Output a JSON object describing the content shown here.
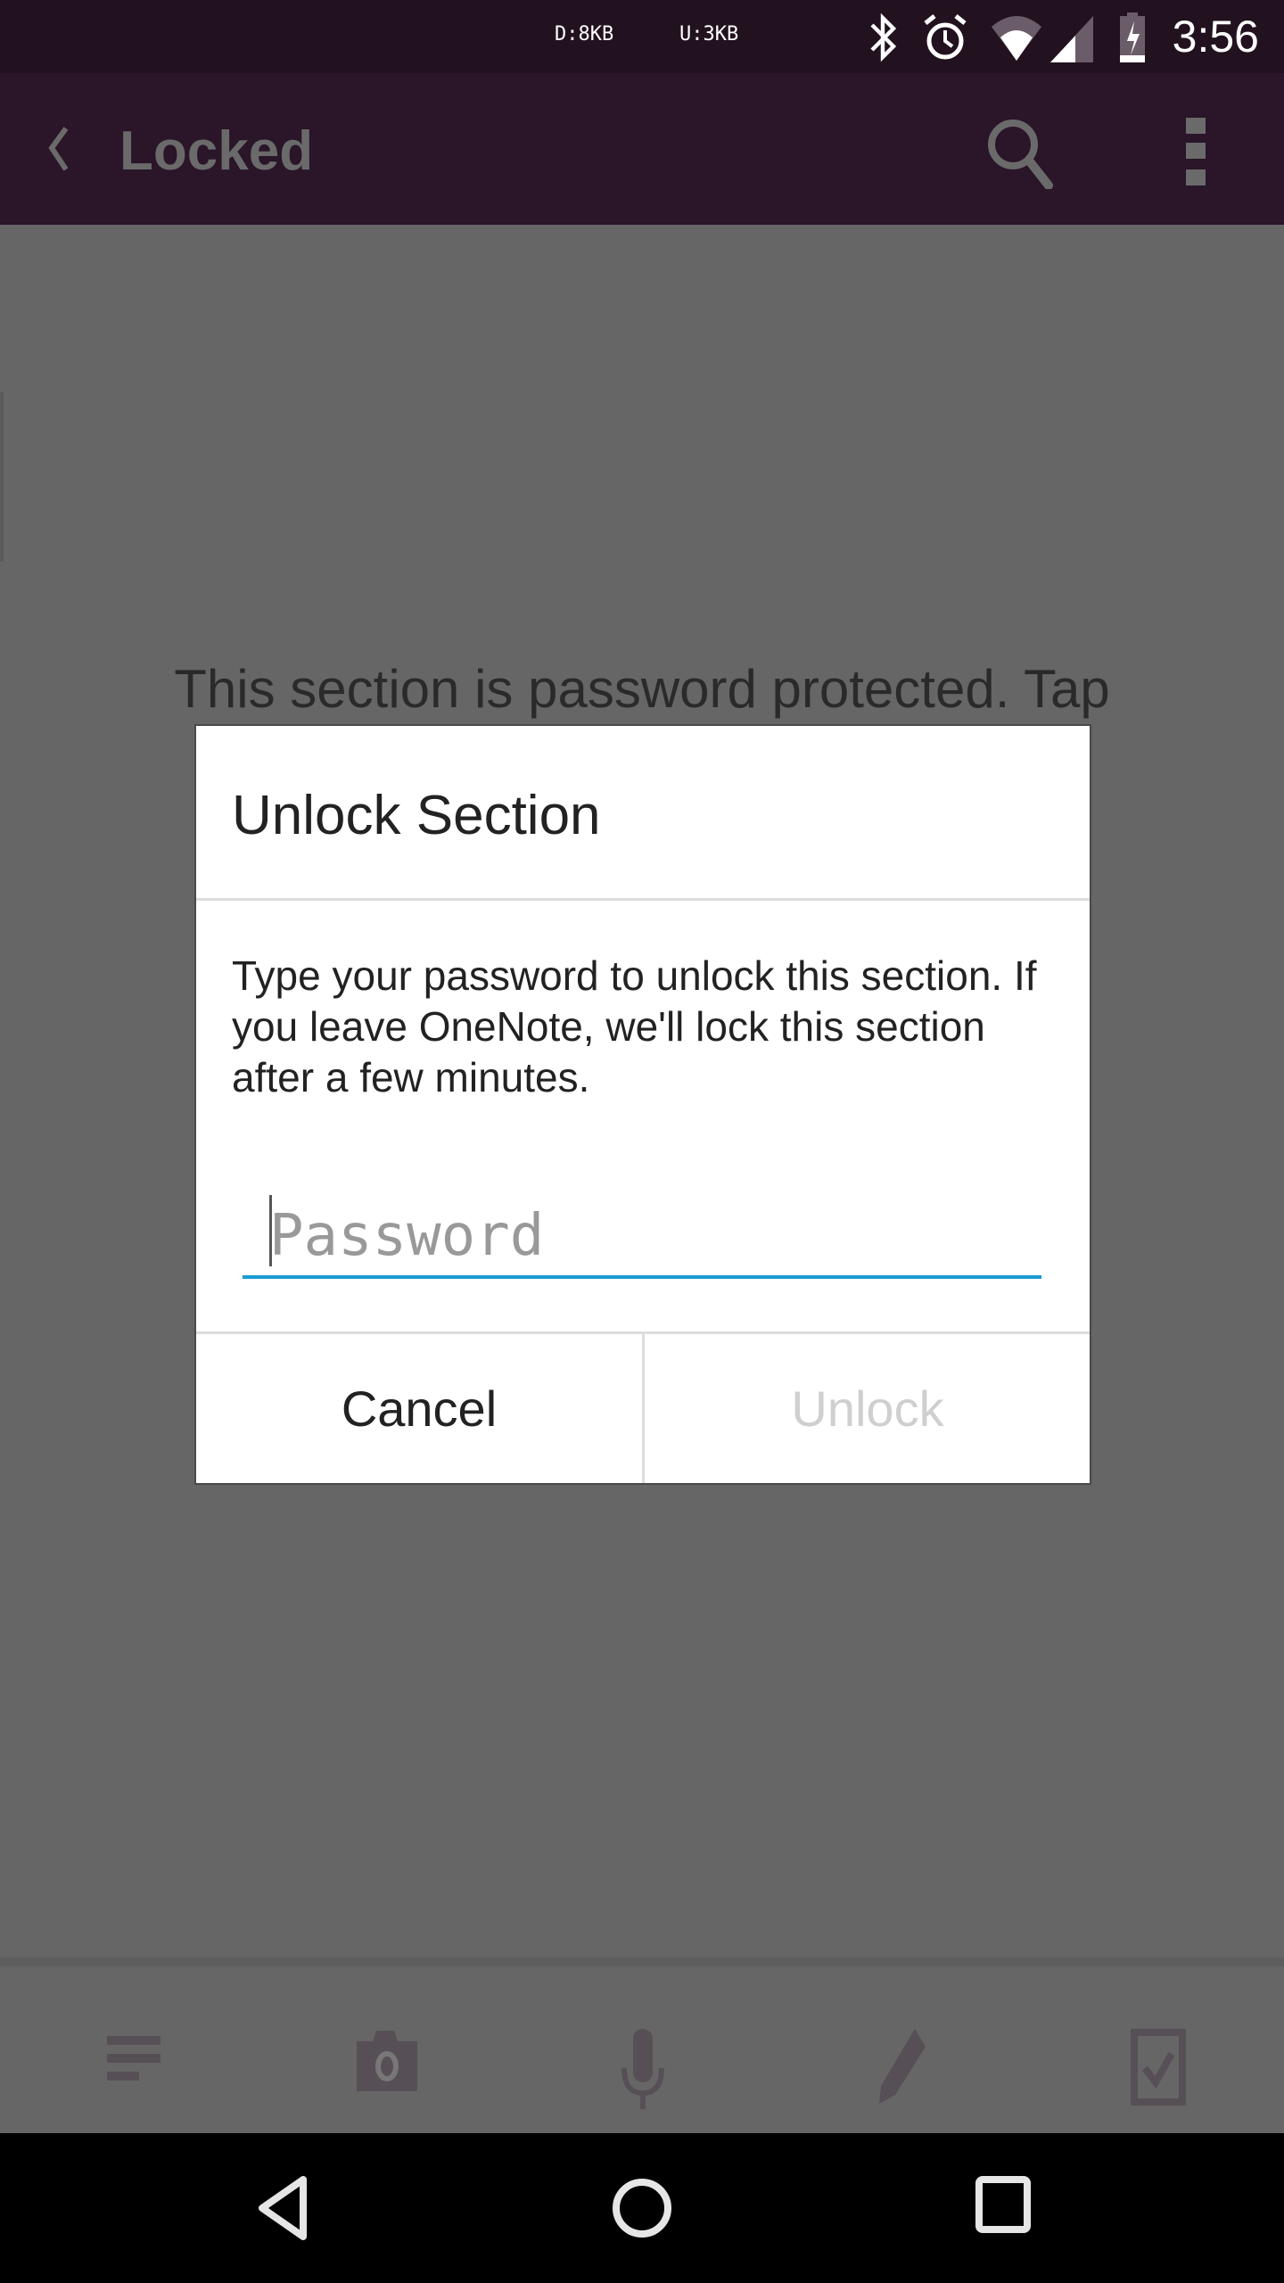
{
  "status_bar": {
    "download": "D:8KB",
    "upload": "U:3KB",
    "time": "3:56",
    "icons": [
      "bluetooth-icon",
      "alarm-icon",
      "wifi-icon",
      "signal-icon",
      "battery-charging-icon"
    ]
  },
  "app_bar": {
    "title": "Locked",
    "icons": [
      "back-chevron-icon",
      "search-icon",
      "more-vert-icon"
    ]
  },
  "main": {
    "message": "This section is password protected. Tap"
  },
  "dialog": {
    "title": "Unlock Section",
    "body": "Type your password to unlock this section. If you leave OneNote, we'll lock this section after a few minutes.",
    "password_value": "",
    "password_placeholder": "Password",
    "cancel_label": "Cancel",
    "unlock_label": "Unlock",
    "accent_color": "#1a9bd0"
  },
  "toolbar": {
    "icons": [
      "text-format-icon",
      "camera-icon",
      "microphone-icon",
      "pen-icon",
      "checkbox-icon"
    ]
  },
  "nav_bar": {
    "icons": [
      "back-icon",
      "home-icon",
      "recents-icon"
    ]
  }
}
